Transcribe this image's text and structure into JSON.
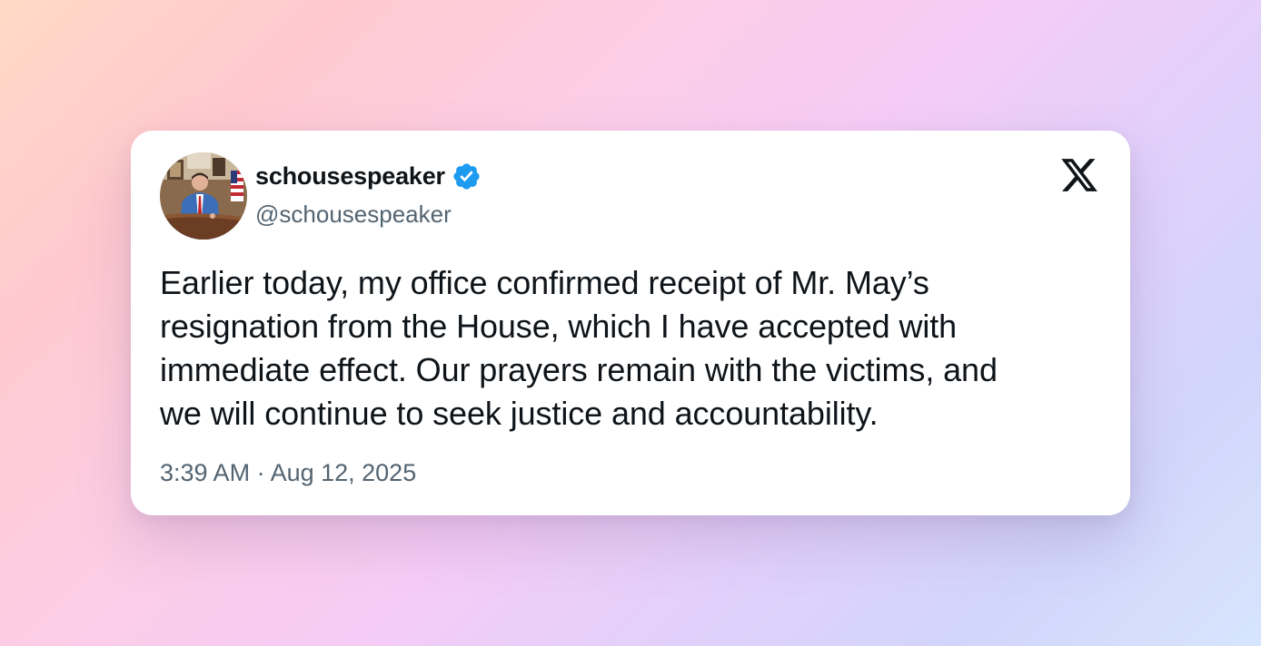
{
  "tweet": {
    "display_name": "schousespeaker",
    "handle": "@schousespeaker",
    "verified": true,
    "text": "Earlier today, my office confirmed receipt of Mr. May’s\nresignation from the House, which I have accepted with\nimmediate effect. Our prayers remain with the victims, and\nwe will continue to seek justice and accountability.",
    "timestamp": "3:39 AM · Aug 12, 2025"
  },
  "icons": {
    "verified": "verified-badge-icon",
    "platform": "x-logo-icon"
  },
  "colors": {
    "verified_blue": "#1d9bf0",
    "text_primary": "#0f1419",
    "text_secondary": "#536471",
    "card_background": "#ffffff"
  }
}
